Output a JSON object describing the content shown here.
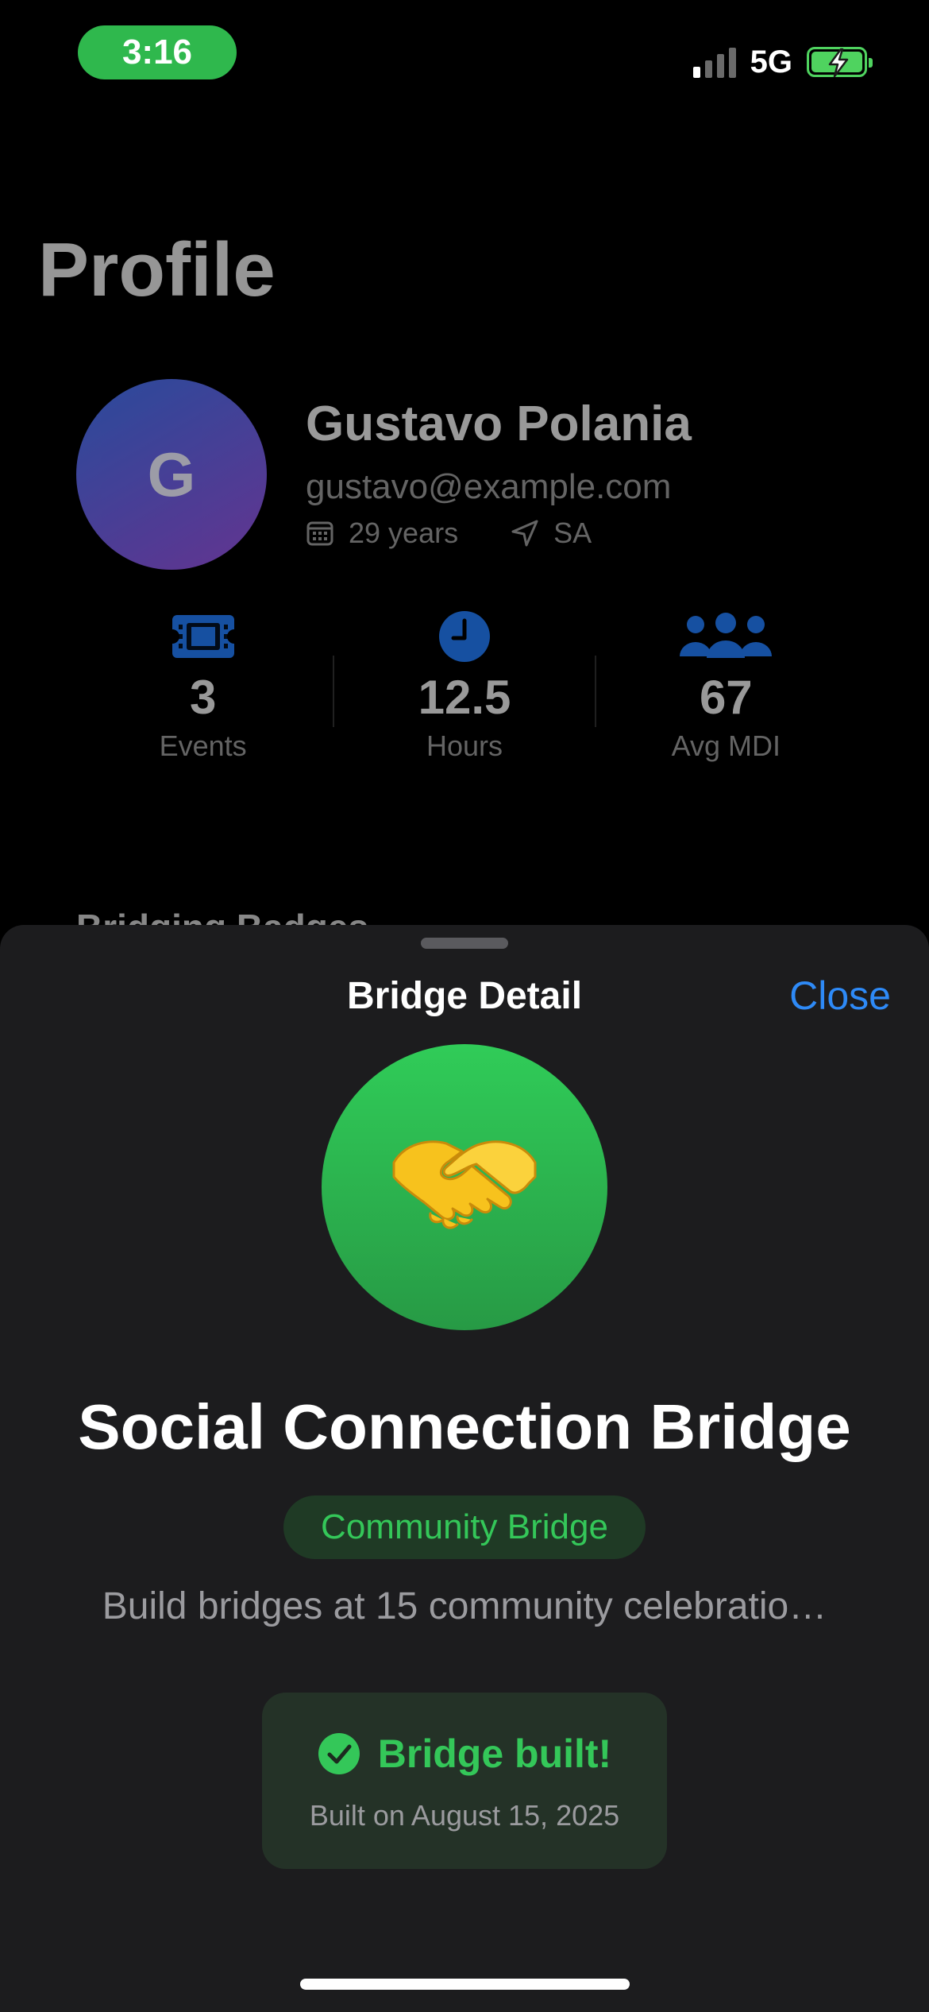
{
  "status_bar": {
    "time": "3:16",
    "network": "5G",
    "signal_bars_active": 1,
    "battery_charging": true,
    "battery_color": "#4fd35f"
  },
  "profile": {
    "page_title": "Profile",
    "avatar_initial": "G",
    "name": "Gustavo Polania",
    "email": "gustavo@example.com",
    "age": "29 years",
    "location": "SA",
    "stats": [
      {
        "icon": "ticket-icon",
        "value": "3",
        "label": "Events"
      },
      {
        "icon": "clock-icon",
        "value": "12.5",
        "label": "Hours"
      },
      {
        "icon": "people-icon",
        "value": "67",
        "label": "Avg MDI"
      }
    ],
    "section_peek": "Bridging Badges"
  },
  "sheet": {
    "title": "Bridge Detail",
    "close_label": "Close",
    "badge_emoji": "🤝",
    "badge_name": "Social Connection Bridge",
    "category": "Community Bridge",
    "description": "Build bridges at 15 community celebratio…",
    "status_text": "Bridge built!",
    "built_date": "Built on August 15, 2025"
  },
  "colors": {
    "accent_blue": "#2e8af7",
    "success_green": "#34c759",
    "stat_icon_blue": "#1f6fe0"
  }
}
